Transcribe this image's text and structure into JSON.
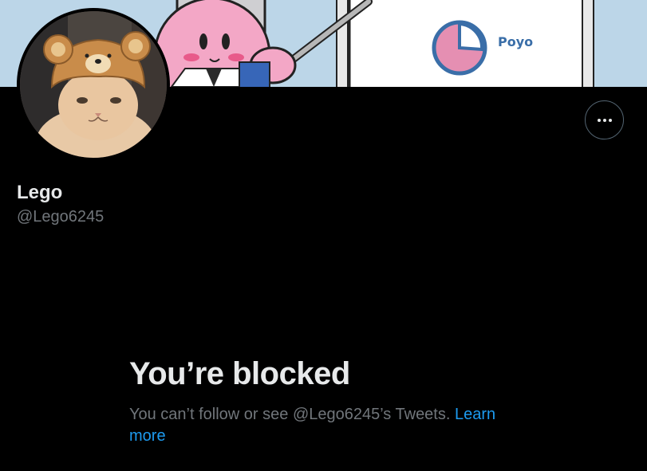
{
  "profile": {
    "display_name": "Lego",
    "handle": "@Lego6245"
  },
  "banner": {
    "sign_text": "Poyo"
  },
  "blocked": {
    "title": "You’re blocked",
    "message": "You can’t follow or see @Lego6245’s Tweets. ",
    "learn_more": "Learn more"
  },
  "colors": {
    "background": "#000000",
    "primary_text": "#e7e9ea",
    "secondary_text": "#71767b",
    "link": "#1d9bf0",
    "border": "#536471"
  },
  "icons": {
    "more": "more-icon"
  }
}
